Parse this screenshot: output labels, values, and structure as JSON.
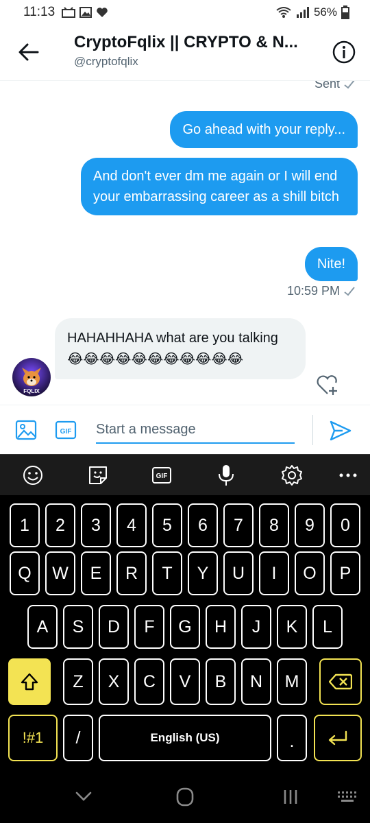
{
  "status_bar": {
    "time": "11:13",
    "battery": "56%"
  },
  "header": {
    "title": "CryptoFqlix || CRYPTO & N...",
    "handle": "@cryptofqlix"
  },
  "chat": {
    "sent_label": "Sent",
    "messages_out": [
      "Go ahead with your reply...",
      "And don't ever dm me again or I will end your embarrassing career as a shill bitch",
      "Nite!"
    ],
    "time_out": "10:59 PM",
    "message_in_text": "HAHAHHAHA what are you talking",
    "message_in_emoji": "😂😂😂😂😂😂😂😂😂😂😂",
    "avatar_label": "FQLIX"
  },
  "composer": {
    "placeholder": "Start a message",
    "gif_label": "GIF"
  },
  "keyboard": {
    "toolbar_gif": "GIF",
    "row_numbers": [
      "1",
      "2",
      "3",
      "4",
      "5",
      "6",
      "7",
      "8",
      "9",
      "0"
    ],
    "row_top": [
      "Q",
      "W",
      "E",
      "R",
      "T",
      "Y",
      "U",
      "I",
      "O",
      "P"
    ],
    "row_mid": [
      "A",
      "S",
      "D",
      "F",
      "G",
      "H",
      "J",
      "K",
      "L"
    ],
    "row_bottom": [
      "Z",
      "X",
      "C",
      "V",
      "B",
      "N",
      "M"
    ],
    "symbols_label": "!#1",
    "slash_label": "/",
    "space_label": "English (US)",
    "period_label": ".",
    "colors": {
      "accent": "#f3e353",
      "key_border": "#ffffff",
      "background": "#000000"
    }
  },
  "colors": {
    "twitter_blue": "#1d9bf0",
    "incoming_bubble": "#eff3f4",
    "muted_text": "#536471"
  }
}
